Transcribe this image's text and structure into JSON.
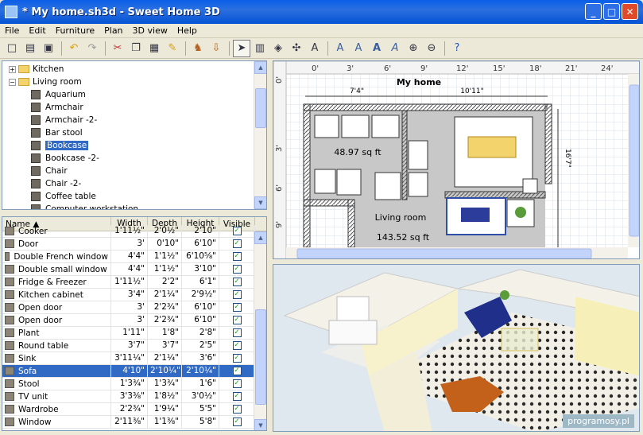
{
  "window": {
    "title": "* My home.sh3d - Sweet Home 3D",
    "minimize": "_",
    "maximize": "□",
    "close": "✕"
  },
  "menu": [
    "File",
    "Edit",
    "Furniture",
    "Plan",
    "3D view",
    "Help"
  ],
  "toolbar_icons": [
    "new-icon",
    "open-icon",
    "save-icon",
    "undo-icon",
    "redo-icon",
    "cut-icon",
    "copy-icon",
    "paste-icon",
    "clean-icon",
    "add-furniture-icon",
    "import-furniture-icon",
    "select-icon",
    "create-walls-icon",
    "create-rooms-icon",
    "create-dimensions-icon",
    "add-text-icon",
    "text-style-1-icon",
    "text-style-2-icon",
    "text-style-3-icon",
    "text-style-4-icon",
    "zoom-in-icon",
    "zoom-out-icon",
    "help-icon"
  ],
  "catalog": {
    "groups": [
      {
        "label": "Kitchen",
        "expanded": false
      },
      {
        "label": "Living room",
        "expanded": true
      }
    ],
    "items": [
      "Aquarium",
      "Armchair",
      "Armchair -2-",
      "Bar stool",
      "Bookcase",
      "Bookcase -2-",
      "Chair",
      "Chair -2-",
      "Coffee table",
      "Computer workstation"
    ],
    "selected": "Bookcase"
  },
  "furniture_table": {
    "columns": [
      "Name ▲",
      "Width",
      "Depth",
      "Height",
      "Visible"
    ],
    "rows": [
      [
        "Cooker",
        "1'11½\"",
        "2'0½\"",
        "2'10\""
      ],
      [
        "Door",
        "3'",
        "0'10\"",
        "6'10\""
      ],
      [
        "Double French window",
        "4'4\"",
        "1'1½\"",
        "6'10⅝\""
      ],
      [
        "Double small window",
        "4'4\"",
        "1'1½\"",
        "3'10\""
      ],
      [
        "Fridge & Freezer",
        "1'11½\"",
        "2'2\"",
        "6'1\""
      ],
      [
        "Kitchen cabinet",
        "3'4\"",
        "2'1¼\"",
        "2'9½\""
      ],
      [
        "Open door",
        "3'",
        "2'2¾\"",
        "6'10\""
      ],
      [
        "Open door",
        "3'",
        "2'2¾\"",
        "6'10\""
      ],
      [
        "Plant",
        "1'11\"",
        "1'8\"",
        "2'8\""
      ],
      [
        "Round table",
        "3'7\"",
        "3'7\"",
        "2'5\""
      ],
      [
        "Sink",
        "3'11¼\"",
        "2'1¼\"",
        "3'6\""
      ],
      [
        "Sofa",
        "4'10\"",
        "2'10¼\"",
        "2'10¼\""
      ],
      [
        "Stool",
        "1'3¾\"",
        "1'3¾\"",
        "1'6\""
      ],
      [
        "TV unit",
        "3'3⅜\"",
        "1'8½\"",
        "3'0½\""
      ],
      [
        "Wardrobe",
        "2'2¾\"",
        "1'9¼\"",
        "5'5\""
      ],
      [
        "Window",
        "2'11⅜\"",
        "1'1⅜\"",
        "5'8\""
      ]
    ],
    "selected_row": "Sofa"
  },
  "plan": {
    "ruler_x": [
      "0'",
      "3'",
      "6'",
      "9'",
      "12'",
      "15'",
      "18'",
      "21'",
      "24'"
    ],
    "ruler_y": [
      "0'",
      "3'",
      "6'",
      "9'"
    ],
    "title": "My home",
    "dim_left": "7'4\"",
    "dim_right": "10'11\"",
    "dim_vertical": "16'7\"",
    "room1_area": "48.97 sq ft",
    "room2_name": "Living room",
    "room2_area": "143.52 sq ft"
  },
  "view3d": {
    "watermark": "programosy.pl"
  },
  "colors": {
    "title_bar": "#0a5fe8",
    "selection": "#316ac5",
    "wall": "#777777",
    "floor_tile": "#c8c8c8"
  }
}
